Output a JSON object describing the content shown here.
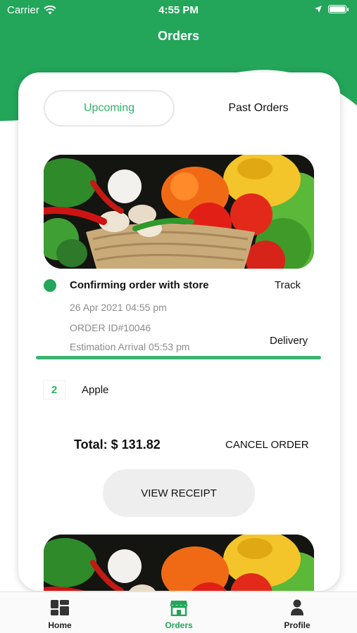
{
  "status_bar": {
    "carrier": "Carrier",
    "time": "4:55 PM"
  },
  "header": {
    "title": "Orders",
    "accent_color": "#23a55a"
  },
  "tabs": [
    {
      "label": "Upcoming",
      "active": true
    },
    {
      "label": "Past Orders",
      "active": false
    }
  ],
  "order": {
    "status": "Confirming order with store",
    "track_label": "Track",
    "date": "26 Apr 2021 04:55 pm",
    "order_id": "ORDER ID#10046",
    "eta": "Estimation Arrival  05:53 pm",
    "delivery_label": "Delivery",
    "progress": 1.0,
    "items": [
      {
        "qty": "2",
        "name": "Apple"
      }
    ],
    "total": "Total: $ 131.82",
    "cancel_label": "CANCEL ORDER",
    "receipt_label": "VIEW RECEIPT"
  },
  "nav": [
    {
      "label": "Home",
      "icon": "dashboard-icon",
      "active": false
    },
    {
      "label": "Orders",
      "icon": "store-icon",
      "active": true
    },
    {
      "label": "Profile",
      "icon": "person-icon",
      "active": false
    }
  ]
}
